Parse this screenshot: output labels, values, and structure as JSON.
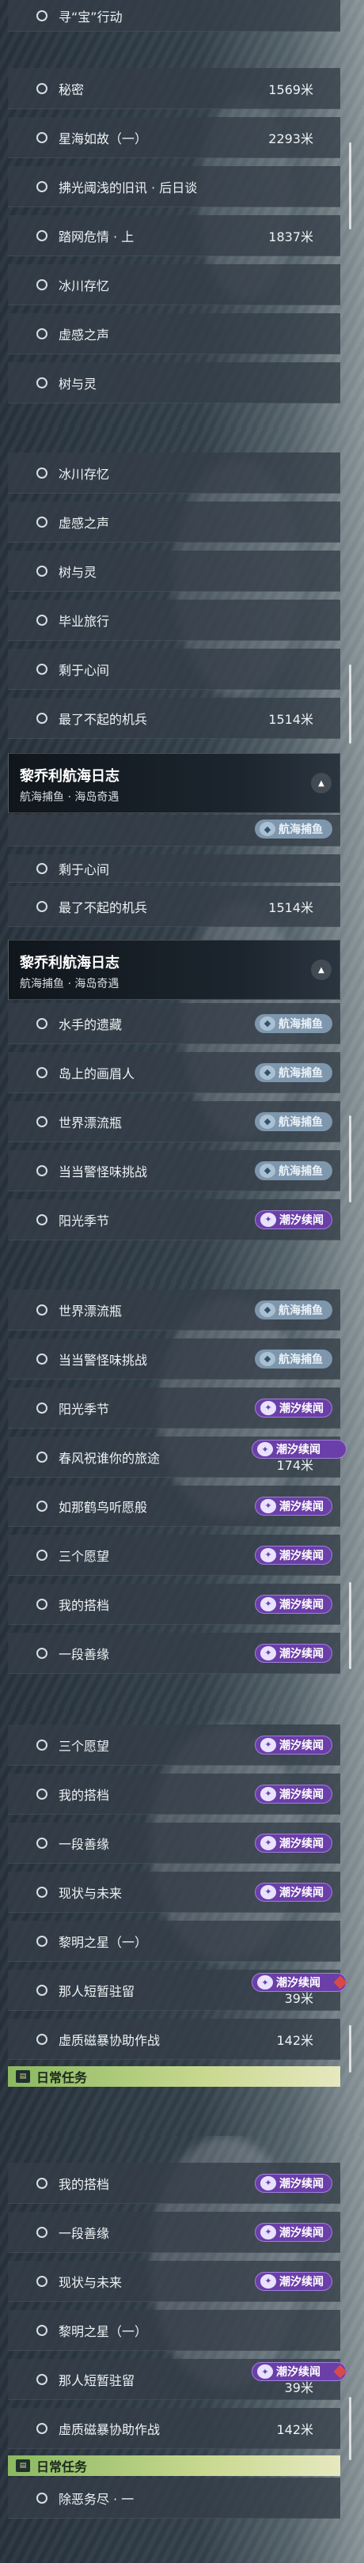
{
  "icons": {
    "unchecked": "circle-outline-icon",
    "collapse": "triangle-up-icon",
    "daily": "book-icon",
    "badge": "tag-icon"
  },
  "colors": {
    "daily_bar": "#a8c878",
    "tide_badge": "#6b3fa8",
    "fish_badge": "#7f97ad",
    "alert": "#d84a4a"
  },
  "tags": {
    "fish": "航海捕鱼",
    "tide": "潮汐续闻"
  },
  "panels": [
    {
      "rows": [
        {
          "label": "寻“宝”行动",
          "dist": ""
        },
        {
          "label": "秘密",
          "dist": "1569米"
        },
        {
          "label": "星海如故（一）",
          "dist": "2293米"
        },
        {
          "label": "拂光阈浅的旧讯 · 后日谈",
          "dist": ""
        },
        {
          "label": "踏网危情 · 上",
          "dist": "1837米"
        },
        {
          "label": "冰川存忆",
          "dist": ""
        },
        {
          "label": "虚感之声",
          "dist": ""
        },
        {
          "label": "树与灵",
          "dist": ""
        }
      ]
    },
    {
      "rows": [
        {
          "label": "冰川存忆",
          "dist": ""
        },
        {
          "label": "虚感之声",
          "dist": ""
        },
        {
          "label": "树与灵",
          "dist": ""
        },
        {
          "label": "毕业旅行",
          "dist": ""
        },
        {
          "label": "剩于心间",
          "dist": ""
        },
        {
          "label": "最了不起的机兵",
          "dist": "1514米"
        }
      ],
      "header": {
        "title": "黎乔利航海日志",
        "subtitle": "航海捕鱼 · 海岛奇遇"
      }
    },
    {
      "rows": [
        {
          "label": "剩于心间",
          "dist": ""
        },
        {
          "label": "最了不起的机兵",
          "dist": "1514米"
        },
        {
          "label": "水手的遗藏",
          "dist": ""
        },
        {
          "label": "岛上的画眉人",
          "dist": ""
        },
        {
          "label": "世界漂流瓶",
          "dist": ""
        },
        {
          "label": "当当警怪味挑战",
          "dist": ""
        },
        {
          "label": "阳光季节",
          "dist": ""
        }
      ],
      "header": {
        "title": "黎乔利航海日志",
        "subtitle": "航海捕鱼 · 海岛奇遇"
      }
    },
    {
      "rows": [
        {
          "label": "世界漂流瓶",
          "dist": ""
        },
        {
          "label": "当当警怪味挑战",
          "dist": ""
        },
        {
          "label": "阳光季节",
          "dist": ""
        },
        {
          "label": "春风祝谁你的旅途",
          "dist": "174米"
        },
        {
          "label": "如那鹤鸟听愿般",
          "dist": ""
        },
        {
          "label": "三个愿望",
          "dist": ""
        },
        {
          "label": "我的搭档",
          "dist": ""
        },
        {
          "label": "一段善缘",
          "dist": ""
        }
      ]
    },
    {
      "rows": [
        {
          "label": "三个愿望",
          "dist": ""
        },
        {
          "label": "我的搭档",
          "dist": ""
        },
        {
          "label": "一段善缘",
          "dist": ""
        },
        {
          "label": "现状与未来",
          "dist": ""
        },
        {
          "label": "黎明之星（一）",
          "dist": ""
        },
        {
          "label": "那人短暂驻留",
          "dist": "39米"
        },
        {
          "label": "虚质磁暴协助作战",
          "dist": "142米"
        }
      ],
      "daily": "日常任务"
    },
    {
      "rows": [
        {
          "label": "我的搭档",
          "dist": ""
        },
        {
          "label": "一段善缘",
          "dist": ""
        },
        {
          "label": "现状与未来",
          "dist": ""
        },
        {
          "label": "黎明之星（一）",
          "dist": ""
        },
        {
          "label": "那人短暂驻留",
          "dist": "39米"
        },
        {
          "label": "虚质磁暴协助作战",
          "dist": "142米"
        },
        {
          "label": "除恶务尽 · 一",
          "dist": ""
        }
      ],
      "daily": "日常任务"
    }
  ]
}
